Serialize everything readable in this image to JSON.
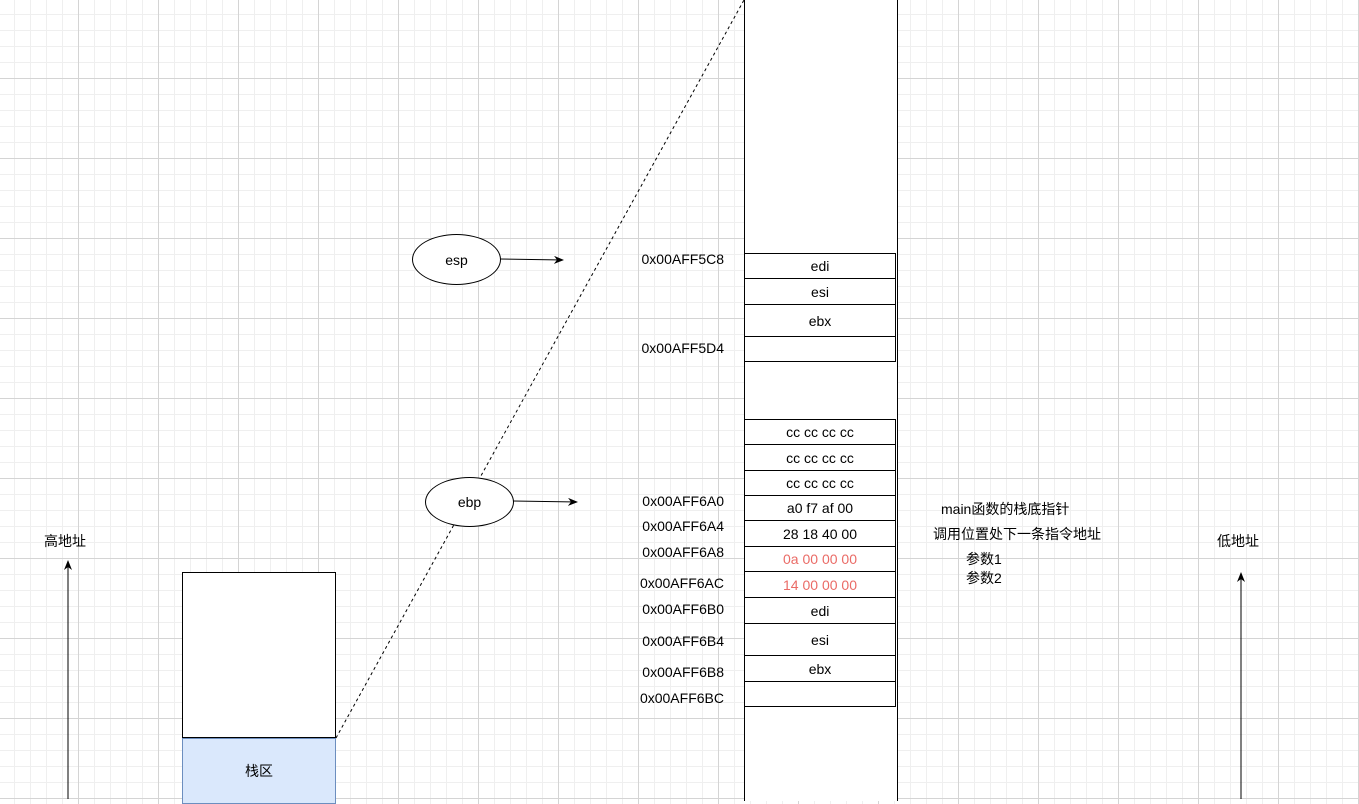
{
  "pointers": {
    "esp": "esp",
    "ebp": "ebp"
  },
  "labels": {
    "high_address": "高地址",
    "low_address": "低地址",
    "stack_area": "栈区"
  },
  "upper_frame": {
    "cells": [
      "edi",
      "esi",
      "ebx",
      ""
    ],
    "addresses": [
      "0x00AFF5C8",
      "0x00AFF5D4"
    ]
  },
  "lower_frame": {
    "fill_cells": [
      "cc cc cc cc",
      "cc cc cc cc",
      "cc cc cc cc"
    ],
    "cells": [
      "a0 f7 af 00",
      "28 18 40 00",
      "0a 00 00 00",
      "14 00 00 00",
      "edi",
      "esi",
      "ebx",
      ""
    ],
    "addresses": [
      "0x00AFF6A0",
      "0x00AFF6A4",
      "0x00AFF6A8",
      "0x00AFF6AC",
      "0x00AFF6B0",
      "0x00AFF6B4",
      "0x00AFF6B8",
      "0x00AFF6BC"
    ]
  },
  "annotations": {
    "main_base_pointer": "main函数的栈底指针",
    "return_address": "调用位置处下一条指令地址",
    "param1": "参数1",
    "param2": "参数2"
  },
  "colors": {
    "param_value": "#ea6b66",
    "stack_fill": "#dae8fc",
    "stack_border": "#6c8ebf",
    "grid": "#d4d4d4"
  }
}
